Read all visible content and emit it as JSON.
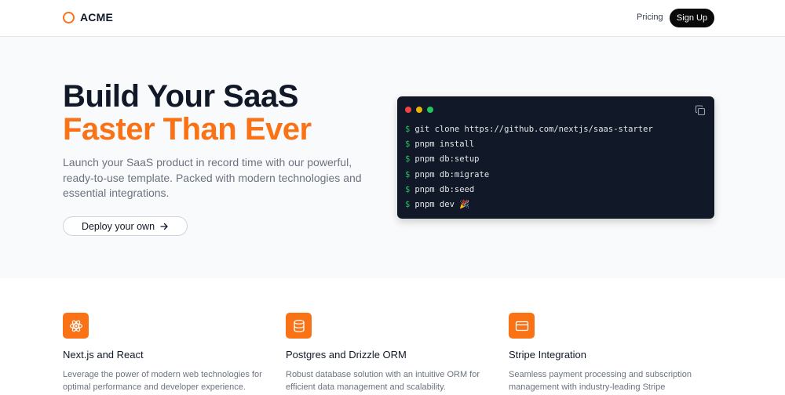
{
  "nav": {
    "brand": "ACME",
    "pricing": "Pricing",
    "signup": "Sign Up"
  },
  "hero": {
    "title_line1": "Build Your SaaS",
    "title_line2": "Faster Than Ever",
    "description": "Launch your SaaS product in record time with our powerful, ready-to-use template. Packed with modern technologies and essential integrations.",
    "cta": "Deploy your own",
    "cta_icon": "arrow-right-icon"
  },
  "terminal": {
    "prompt": "$",
    "lines": [
      "git clone https://github.com/nextjs/saas-starter",
      "pnpm install",
      "pnpm db:setup",
      "pnpm db:migrate",
      "pnpm db:seed",
      "pnpm dev 🎉"
    ]
  },
  "features": [
    {
      "icon": "react-atom-icon",
      "title": "Next.js and React",
      "description": "Leverage the power of modern web technologies for optimal performance and developer experience."
    },
    {
      "icon": "database-icon",
      "title": "Postgres and Drizzle ORM",
      "description": "Robust database solution with an intuitive ORM for efficient data management and scalability."
    },
    {
      "icon": "credit-card-icon",
      "title": "Stripe Integration",
      "description": "Seamless payment processing and subscription management with industry-leading Stripe"
    }
  ],
  "colors": {
    "accent": "#f97316",
    "terminal_bg": "#111827",
    "prompt": "#22c55e"
  }
}
